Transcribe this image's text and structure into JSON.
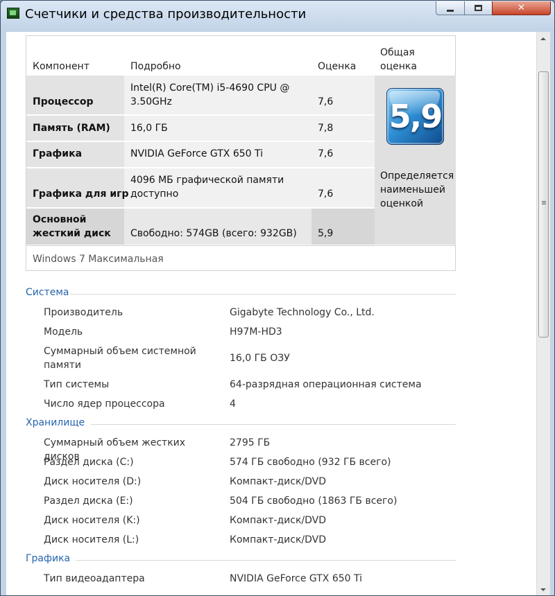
{
  "window": {
    "title": "Счетчики и средства производительности"
  },
  "scores": {
    "headers": {
      "component": "Компонент",
      "details": "Подробно",
      "rating": "Оценка",
      "overall_line1": "Общая",
      "overall_line2": "оценка"
    },
    "rows": [
      {
        "component": "Процессор",
        "details_line1": "Intel(R) Core(TM) i5-4690 CPU @",
        "details_line2": "3.50GHz",
        "rating": "7,6"
      },
      {
        "component": "Память (RAM)",
        "details": "16,0 ГБ",
        "rating": "7,8"
      },
      {
        "component": "Графика",
        "details": "NVIDIA GeForce GTX 650 Ti",
        "rating": "7,6"
      },
      {
        "component": "Графика для игр",
        "details_line1": "4096 МБ графической памяти",
        "details_line2": "доступно",
        "rating": "7,6"
      },
      {
        "component_line1": "Основной",
        "component_line2": "жесткий диск",
        "details": "Свободно: 574GB (всего: 932GB)",
        "rating": "5,9"
      }
    ],
    "overall_score": "5,9",
    "overall_note_line1": "Определяется",
    "overall_note_line2": "наименьшей",
    "overall_note_line3": "оценкой",
    "os_edition": "Windows 7 Максимальная"
  },
  "system": {
    "title": "Система",
    "items": [
      {
        "key": "Производитель",
        "value": "Gigabyte Technology Co., Ltd."
      },
      {
        "key": "Модель",
        "value": "H97M-HD3"
      },
      {
        "key_line1": "Суммарный объем системной",
        "key_line2": "памяти",
        "value": "16,0 ГБ ОЗУ"
      },
      {
        "key": "Тип системы",
        "value": "64-разрядная операционная система"
      },
      {
        "key": "Число ядер процессора",
        "value": "4"
      }
    ]
  },
  "storage": {
    "title": "Хранилище",
    "items": [
      {
        "key": "Суммарный объем жестких дисков",
        "value": "2795 ГБ"
      },
      {
        "key": "Раздел диска (C:)",
        "value": "574 ГБ свободно (932 ГБ всего)"
      },
      {
        "key": "Диск носителя (D:)",
        "value": "Компакт-диск/DVD"
      },
      {
        "key": "Раздел диска (E:)",
        "value": "504 ГБ свободно (1863 ГБ всего)"
      },
      {
        "key": "Диск носителя (K:)",
        "value": "Компакт-диск/DVD"
      },
      {
        "key": "Диск носителя (L:)",
        "value": "Компакт-диск/DVD"
      }
    ]
  },
  "graphics": {
    "title": "Графика",
    "items": [
      {
        "key": "Тип видеоадаптера",
        "value": "NVIDIA GeForce GTX 650 Ti"
      }
    ]
  }
}
